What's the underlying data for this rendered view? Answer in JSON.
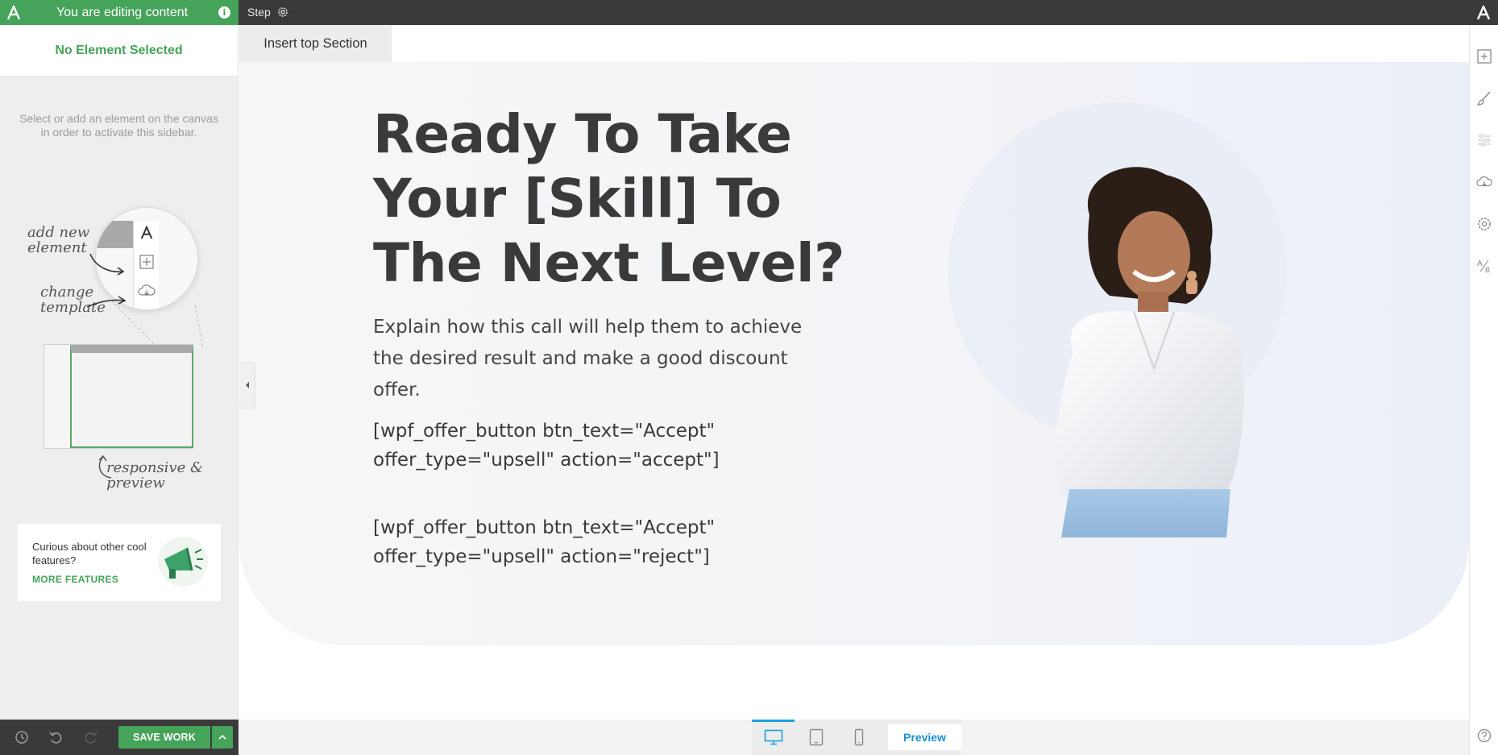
{
  "topbar": {
    "editing_text": "You are editing content",
    "step_label": "Step"
  },
  "sidebar": {
    "header": "No Element Selected",
    "hint": "Select or add an element on the canvas in order to activate this sidebar.",
    "illustration": {
      "add_new_element": "add new element",
      "change_template": "change template",
      "responsive_preview": "responsive & preview"
    },
    "features_card": {
      "text": "Curious about other cool features?",
      "link": "MORE FEATURES"
    }
  },
  "savebar": {
    "save_label": "SAVE WORK"
  },
  "canvas": {
    "insert_top_label": "Insert top Section",
    "hero": {
      "title": "Ready To Take Your [Skill] To The Next Level?",
      "subtitle": "Explain how this call will help them to achieve the desired result and make a good discount offer.",
      "shortcode_accept": "[wpf_offer_button btn_text=\"Accept\" offer_type=\"upsell\" action=\"accept\"]",
      "shortcode_reject": "[wpf_offer_button btn_text=\"Accept\" offer_type=\"upsell\" action=\"reject\"]"
    }
  },
  "device_bar": {
    "preview_label": "Preview",
    "active_device": "desktop"
  },
  "colors": {
    "brand_green": "#46a35a",
    "dark_bar": "#3a3a3a",
    "accent_blue": "#1aa3e0"
  },
  "icons": {
    "right_rail": [
      "add-icon",
      "brush-icon",
      "sliders-icon",
      "cloud-download-icon",
      "gear-icon",
      "ab-test-icon",
      "help-icon"
    ],
    "savebar": [
      "history-icon",
      "undo-icon",
      "redo-icon"
    ]
  }
}
